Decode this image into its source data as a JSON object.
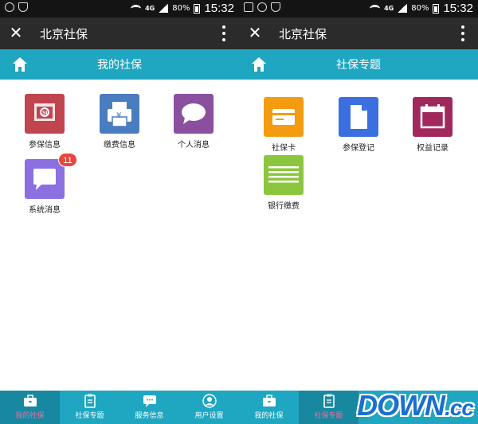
{
  "left_screen": {
    "status": {
      "network": "4G",
      "battery": "80%",
      "time": "15:32"
    },
    "window_title": "北京社保",
    "section_title": "我的社保",
    "tiles": [
      {
        "label": "参保信息",
        "icon": "social-security-card-icon",
        "color": "#c0454f"
      },
      {
        "label": "缴费信息",
        "icon": "printer-icon",
        "color": "#4a7cc0",
        "symbol": "¥"
      },
      {
        "label": "个人消息",
        "icon": "speech-bubble-icon",
        "color": "#8a4f9e"
      },
      {
        "label": "系统消息",
        "icon": "message-icon",
        "color": "#8c6fe0",
        "badge": "11"
      }
    ],
    "tabs": [
      {
        "label": "我的社保",
        "icon": "briefcase-icon",
        "active": true
      },
      {
        "label": "社保专题",
        "icon": "clipboard-icon",
        "active": false
      },
      {
        "label": "服务信息",
        "icon": "chat-icon",
        "active": false
      },
      {
        "label": "用户设置",
        "icon": "user-icon",
        "active": false
      }
    ]
  },
  "right_screen": {
    "status": {
      "network": "4G",
      "battery": "80%",
      "time": "15:32"
    },
    "window_title": "北京社保",
    "section_title": "社保专题",
    "tiles": [
      {
        "label": "社保卡",
        "icon": "card-icon",
        "color": "#f39c12"
      },
      {
        "label": "参保登记",
        "icon": "document-icon",
        "color": "#3b6fe0"
      },
      {
        "label": "权益记录",
        "icon": "calendar-icon",
        "color": "#a0285c"
      },
      {
        "label": "银行缴费",
        "icon": "list-lines-icon",
        "color": "#8cc63f"
      }
    ],
    "tabs": [
      {
        "label": "我的社保",
        "icon": "briefcase-icon",
        "active": false
      },
      {
        "label": "社保专题",
        "icon": "clipboard-icon",
        "active": true
      }
    ]
  },
  "watermark": {
    "main": "DOWN",
    "suffix": ".cc"
  },
  "colors": {
    "accent": "#1fa6c1",
    "titlebar": "#2b2b2b",
    "active_tab_label": "#f26da3",
    "badge": "#e9463f"
  }
}
